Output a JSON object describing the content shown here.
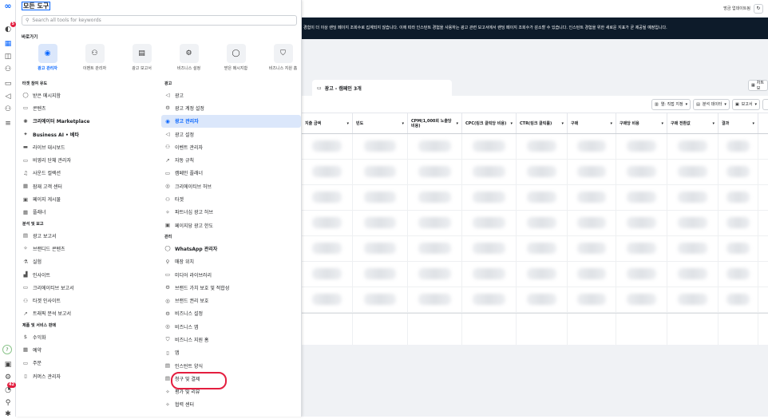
{
  "menu": {
    "title": "모든 도구",
    "search_placeholder": "Search all tools for keywords",
    "shortcuts_heading": "바로가기",
    "shortcuts": [
      {
        "label": "광고 관리자",
        "icon": "ads-manager-icon",
        "glyph": "◉"
      },
      {
        "label": "이벤트 관리자",
        "icon": "events-manager-icon",
        "glyph": "⚇"
      },
      {
        "label": "광고 보고서",
        "icon": "ads-report-icon",
        "glyph": "▤"
      },
      {
        "label": "비즈니스 설정",
        "icon": "gear-icon",
        "glyph": "⚙"
      },
      {
        "label": "받은 메시지함",
        "icon": "message-icon",
        "glyph": "◯"
      },
      {
        "label": "비즈니스 지원 홈",
        "icon": "shield-icon",
        "glyph": "⛉"
      }
    ],
    "col1": [
      {
        "type": "section",
        "label": "타겟 참여 유도"
      },
      {
        "label": "받은 메시지함",
        "glyph": "◯"
      },
      {
        "label": "콘텐츠",
        "glyph": "▭"
      },
      {
        "label": "크리에이터 Marketplace",
        "glyph": "✺",
        "bold": true
      },
      {
        "label": "Business AI • 베타",
        "glyph": "✦",
        "bold": true
      },
      {
        "label": "라이브 대시보드",
        "glyph": "▬"
      },
      {
        "label": "비영리 단체 관리자",
        "glyph": "▭"
      },
      {
        "label": "사운드 컬렉션",
        "glyph": "♫"
      },
      {
        "label": "잠재 고객 센터",
        "glyph": "▦"
      },
      {
        "label": "페이지 게시물",
        "glyph": "▣"
      },
      {
        "label": "플래너",
        "glyph": "▦"
      },
      {
        "type": "section",
        "label": "분석 및 보고"
      },
      {
        "label": "광고 보고서",
        "glyph": "▤"
      },
      {
        "label": "브랜디드 콘텐츠",
        "glyph": "✧"
      },
      {
        "label": "실험",
        "glyph": "⚗"
      },
      {
        "label": "인사이트",
        "glyph": "▟"
      },
      {
        "label": "크리에이티브 보고서",
        "glyph": "▭"
      },
      {
        "label": "타겟 인사이트",
        "glyph": "⚇"
      },
      {
        "label": "트래픽 분석 보고서",
        "glyph": "↗"
      },
      {
        "type": "section",
        "label": "제품 및 서비스 판매"
      },
      {
        "label": "수익화",
        "glyph": "$"
      },
      {
        "label": "예약",
        "glyph": "▦"
      },
      {
        "label": "주문",
        "glyph": "▭"
      },
      {
        "label": "커머스 관리자",
        "glyph": "▯"
      }
    ],
    "col2": [
      {
        "type": "section",
        "label": "광고"
      },
      {
        "label": "광고",
        "glyph": "◁"
      },
      {
        "label": "광고 계정 설정",
        "glyph": "⚙"
      },
      {
        "label": "광고 관리자",
        "glyph": "◉",
        "active": true
      },
      {
        "label": "광고 설정",
        "glyph": "◁"
      },
      {
        "label": "이벤트 관리자",
        "glyph": "⚇"
      },
      {
        "label": "자동 규칙",
        "glyph": "↗"
      },
      {
        "label": "캠페인 플래너",
        "glyph": "▭"
      },
      {
        "label": "크리에이티브 허브",
        "glyph": "◎"
      },
      {
        "label": "타겟",
        "glyph": "⚇"
      },
      {
        "label": "파트너십 광고 허브",
        "glyph": "✧"
      },
      {
        "label": "페이지당 광고 한도",
        "glyph": "▣"
      },
      {
        "type": "section",
        "label": "관리"
      },
      {
        "label": "WhatsApp 관리자",
        "glyph": "◯",
        "bold": true
      },
      {
        "label": "매장 위치",
        "glyph": "⚲"
      },
      {
        "label": "미디어 라이브러리",
        "glyph": "▭"
      },
      {
        "label": "브랜드 가치 보호 및 적합성",
        "glyph": "⚙"
      },
      {
        "label": "브랜드 권리 보호",
        "glyph": "◎"
      },
      {
        "label": "비즈니스 설정",
        "glyph": "⚙"
      },
      {
        "label": "비즈니스 앱",
        "glyph": "◎"
      },
      {
        "label": "비즈니스 지원 홈",
        "glyph": "⛉"
      },
      {
        "label": "앱",
        "glyph": "▯"
      },
      {
        "label": "인스턴트 양식",
        "glyph": "▤"
      },
      {
        "label": "청구 및 결제",
        "glyph": "▤",
        "circled": true
      },
      {
        "label": "평가 및 리뷰",
        "glyph": "✧"
      },
      {
        "label": "협력 센터",
        "glyph": "✧"
      }
    ]
  },
  "rail": {
    "badge_top": "5",
    "badge_bottom": "42"
  },
  "app": {
    "update_text": "방금 업데이트됨",
    "notice": "경험이 더 이상 랜딩 페이지 조회수로 집계되지 않습니다. 이에 따라 인스턴트 경험을 사용하는 광고 관련 보고서에서 랜딩 페이지 조회수가 감소할 수 있습니다. 인스턴트 경험을 위한 새로운 지표가 곧 제공될 예정입니다.",
    "tab_label": "광고 - 캠페인 3개",
    "report_btn": "차트 보",
    "toolbar": {
      "columns": "열: 직접 지정",
      "breakdown": "분석 데이터",
      "reports": "보고서"
    },
    "columns": [
      "지출 금액",
      "빈도",
      "CPM(1,000회 노출당 비용)",
      "CPC(링크 클릭당 비용)",
      "CTR(링크 클릭률)",
      "구매",
      "구매당 비용",
      "구매 전환값",
      "결과"
    ]
  },
  "colors": {
    "accent": "#0866ff",
    "highlight_bg": "#dbe7fb",
    "alert": "#e41e3f",
    "notice_bg": "#0d1b2a"
  }
}
